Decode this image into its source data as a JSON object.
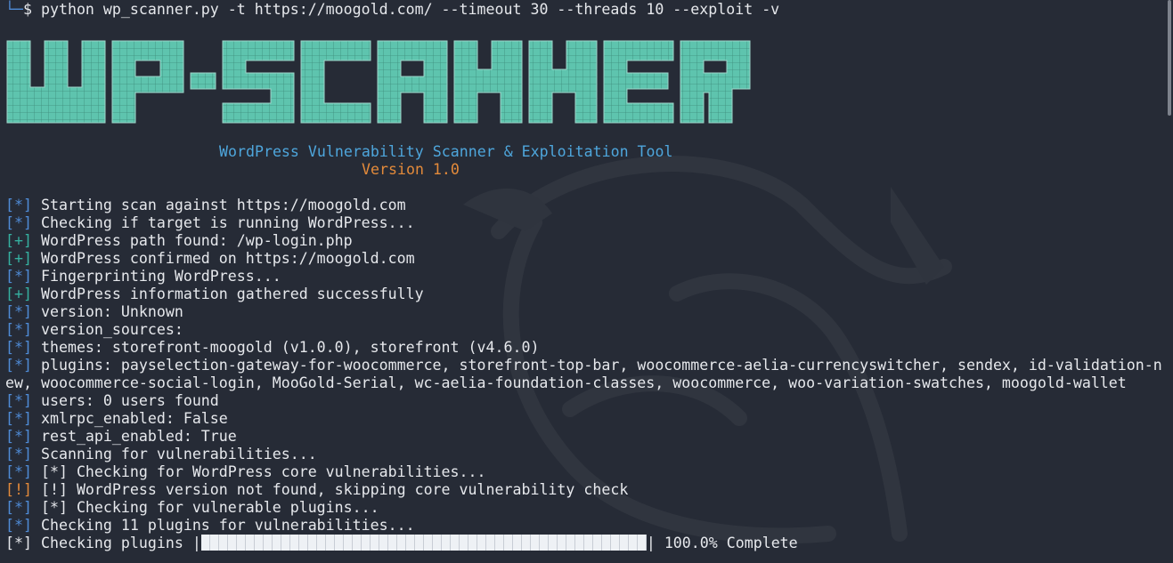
{
  "prompt": {
    "corner": "└─",
    "symbol": "$",
    "command": "python wp_scanner.py -t https://moogold.com/ --timeout 30 --threads 10 --exploit -v"
  },
  "banner": {
    "logo_text": "WP-SCANNER",
    "subtitle": "WordPress Vulnerability Scanner & Exploitation Tool",
    "version": "Version 1.0"
  },
  "colors": {
    "background": "#262b36",
    "banner_fill": "#5ec4ae",
    "info_tag": "#4f8bd6",
    "success_tag": "#35b0a0",
    "warning_tag": "#e38a3a",
    "subtitle": "#4ea6dc"
  },
  "log": [
    {
      "tag": "[*]",
      "kind": "star",
      "text": "Starting scan against https://moogold.com"
    },
    {
      "tag": "[*]",
      "kind": "star",
      "text": "Checking if target is running WordPress..."
    },
    {
      "tag": "[+]",
      "kind": "plus",
      "text": "WordPress path found: /wp-login.php"
    },
    {
      "tag": "[+]",
      "kind": "plus",
      "text": "WordPress confirmed on https://moogold.com"
    },
    {
      "tag": "[*]",
      "kind": "star",
      "text": "Fingerprinting WordPress..."
    },
    {
      "tag": "[+]",
      "kind": "plus",
      "text": "WordPress information gathered successfully"
    },
    {
      "tag": "[*]",
      "kind": "star",
      "text": "version: Unknown"
    },
    {
      "tag": "[*]",
      "kind": "star",
      "text": "version_sources:"
    },
    {
      "tag": "[*]",
      "kind": "star",
      "text": "themes: storefront-moogold (v1.0.0), storefront (v4.6.0)"
    },
    {
      "tag": "[*]",
      "kind": "star",
      "text": "plugins: payselection-gateway-for-woocommerce, storefront-top-bar, woocommerce-aelia-currencyswitcher, sendex, id-validation-n"
    },
    {
      "tag": "",
      "kind": "none",
      "text": "ew, woocommerce-social-login, MooGold-Serial, wc-aelia-foundation-classes, woocommerce, woo-variation-swatches, moogold-wallet"
    },
    {
      "tag": "[*]",
      "kind": "star",
      "text": "users: 0 users found"
    },
    {
      "tag": "[*]",
      "kind": "star",
      "text": "xmlrpc_enabled: False"
    },
    {
      "tag": "[*]",
      "kind": "star",
      "text": "rest_api_enabled: True"
    },
    {
      "tag": "[*]",
      "kind": "star",
      "text": "Scanning for vulnerabilities..."
    },
    {
      "tag": "[*]",
      "kind": "star",
      "text": "[*] Checking for WordPress core vulnerabilities..."
    },
    {
      "tag": "[!]",
      "kind": "warn",
      "text": "[!] WordPress version not found, skipping core vulnerability check"
    },
    {
      "tag": "[*]",
      "kind": "star",
      "text": "[*] Checking for vulnerable plugins..."
    },
    {
      "tag": "[*]",
      "kind": "star",
      "text": "Checking 11 plugins for vulnerabilities..."
    }
  ],
  "progress": {
    "tag": "[*]",
    "label": "Checking plugins |",
    "end": "|",
    "percent_text": "100.0% Complete",
    "fraction": 1.0
  }
}
